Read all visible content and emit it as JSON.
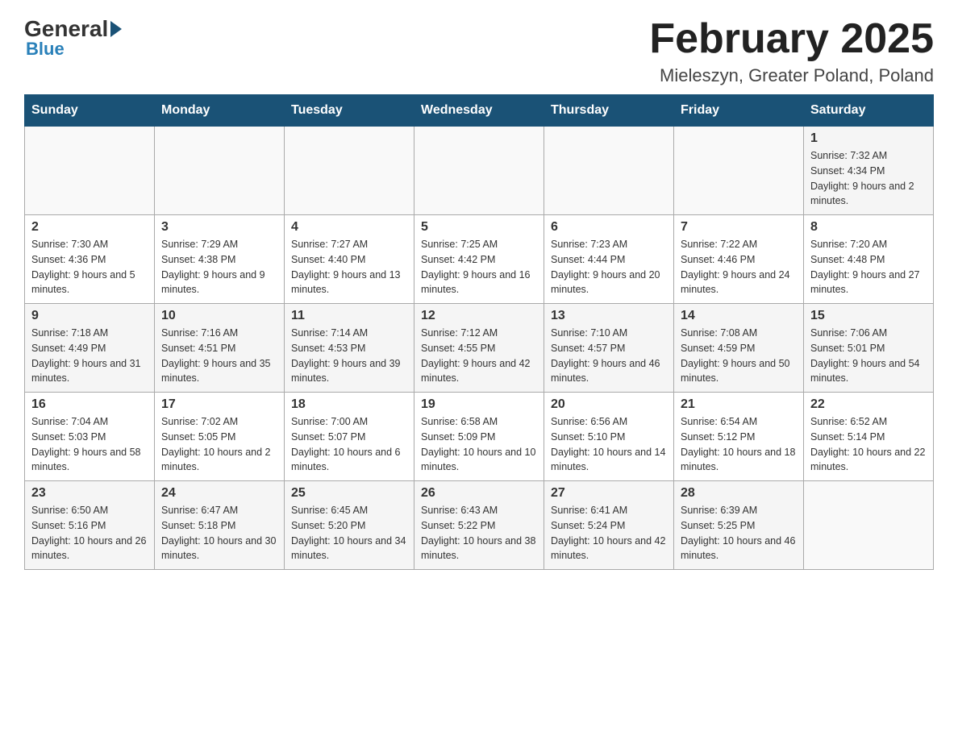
{
  "header": {
    "logo_general": "General",
    "logo_blue": "Blue",
    "month_title": "February 2025",
    "location": "Mieleszyn, Greater Poland, Poland"
  },
  "weekdays": [
    "Sunday",
    "Monday",
    "Tuesday",
    "Wednesday",
    "Thursday",
    "Friday",
    "Saturday"
  ],
  "weeks": [
    [
      {
        "day": "",
        "info": ""
      },
      {
        "day": "",
        "info": ""
      },
      {
        "day": "",
        "info": ""
      },
      {
        "day": "",
        "info": ""
      },
      {
        "day": "",
        "info": ""
      },
      {
        "day": "",
        "info": ""
      },
      {
        "day": "1",
        "info": "Sunrise: 7:32 AM\nSunset: 4:34 PM\nDaylight: 9 hours and 2 minutes."
      }
    ],
    [
      {
        "day": "2",
        "info": "Sunrise: 7:30 AM\nSunset: 4:36 PM\nDaylight: 9 hours and 5 minutes."
      },
      {
        "day": "3",
        "info": "Sunrise: 7:29 AM\nSunset: 4:38 PM\nDaylight: 9 hours and 9 minutes."
      },
      {
        "day": "4",
        "info": "Sunrise: 7:27 AM\nSunset: 4:40 PM\nDaylight: 9 hours and 13 minutes."
      },
      {
        "day": "5",
        "info": "Sunrise: 7:25 AM\nSunset: 4:42 PM\nDaylight: 9 hours and 16 minutes."
      },
      {
        "day": "6",
        "info": "Sunrise: 7:23 AM\nSunset: 4:44 PM\nDaylight: 9 hours and 20 minutes."
      },
      {
        "day": "7",
        "info": "Sunrise: 7:22 AM\nSunset: 4:46 PM\nDaylight: 9 hours and 24 minutes."
      },
      {
        "day": "8",
        "info": "Sunrise: 7:20 AM\nSunset: 4:48 PM\nDaylight: 9 hours and 27 minutes."
      }
    ],
    [
      {
        "day": "9",
        "info": "Sunrise: 7:18 AM\nSunset: 4:49 PM\nDaylight: 9 hours and 31 minutes."
      },
      {
        "day": "10",
        "info": "Sunrise: 7:16 AM\nSunset: 4:51 PM\nDaylight: 9 hours and 35 minutes."
      },
      {
        "day": "11",
        "info": "Sunrise: 7:14 AM\nSunset: 4:53 PM\nDaylight: 9 hours and 39 minutes."
      },
      {
        "day": "12",
        "info": "Sunrise: 7:12 AM\nSunset: 4:55 PM\nDaylight: 9 hours and 42 minutes."
      },
      {
        "day": "13",
        "info": "Sunrise: 7:10 AM\nSunset: 4:57 PM\nDaylight: 9 hours and 46 minutes."
      },
      {
        "day": "14",
        "info": "Sunrise: 7:08 AM\nSunset: 4:59 PM\nDaylight: 9 hours and 50 minutes."
      },
      {
        "day": "15",
        "info": "Sunrise: 7:06 AM\nSunset: 5:01 PM\nDaylight: 9 hours and 54 minutes."
      }
    ],
    [
      {
        "day": "16",
        "info": "Sunrise: 7:04 AM\nSunset: 5:03 PM\nDaylight: 9 hours and 58 minutes."
      },
      {
        "day": "17",
        "info": "Sunrise: 7:02 AM\nSunset: 5:05 PM\nDaylight: 10 hours and 2 minutes."
      },
      {
        "day": "18",
        "info": "Sunrise: 7:00 AM\nSunset: 5:07 PM\nDaylight: 10 hours and 6 minutes."
      },
      {
        "day": "19",
        "info": "Sunrise: 6:58 AM\nSunset: 5:09 PM\nDaylight: 10 hours and 10 minutes."
      },
      {
        "day": "20",
        "info": "Sunrise: 6:56 AM\nSunset: 5:10 PM\nDaylight: 10 hours and 14 minutes."
      },
      {
        "day": "21",
        "info": "Sunrise: 6:54 AM\nSunset: 5:12 PM\nDaylight: 10 hours and 18 minutes."
      },
      {
        "day": "22",
        "info": "Sunrise: 6:52 AM\nSunset: 5:14 PM\nDaylight: 10 hours and 22 minutes."
      }
    ],
    [
      {
        "day": "23",
        "info": "Sunrise: 6:50 AM\nSunset: 5:16 PM\nDaylight: 10 hours and 26 minutes."
      },
      {
        "day": "24",
        "info": "Sunrise: 6:47 AM\nSunset: 5:18 PM\nDaylight: 10 hours and 30 minutes."
      },
      {
        "day": "25",
        "info": "Sunrise: 6:45 AM\nSunset: 5:20 PM\nDaylight: 10 hours and 34 minutes."
      },
      {
        "day": "26",
        "info": "Sunrise: 6:43 AM\nSunset: 5:22 PM\nDaylight: 10 hours and 38 minutes."
      },
      {
        "day": "27",
        "info": "Sunrise: 6:41 AM\nSunset: 5:24 PM\nDaylight: 10 hours and 42 minutes."
      },
      {
        "day": "28",
        "info": "Sunrise: 6:39 AM\nSunset: 5:25 PM\nDaylight: 10 hours and 46 minutes."
      },
      {
        "day": "",
        "info": ""
      }
    ]
  ]
}
